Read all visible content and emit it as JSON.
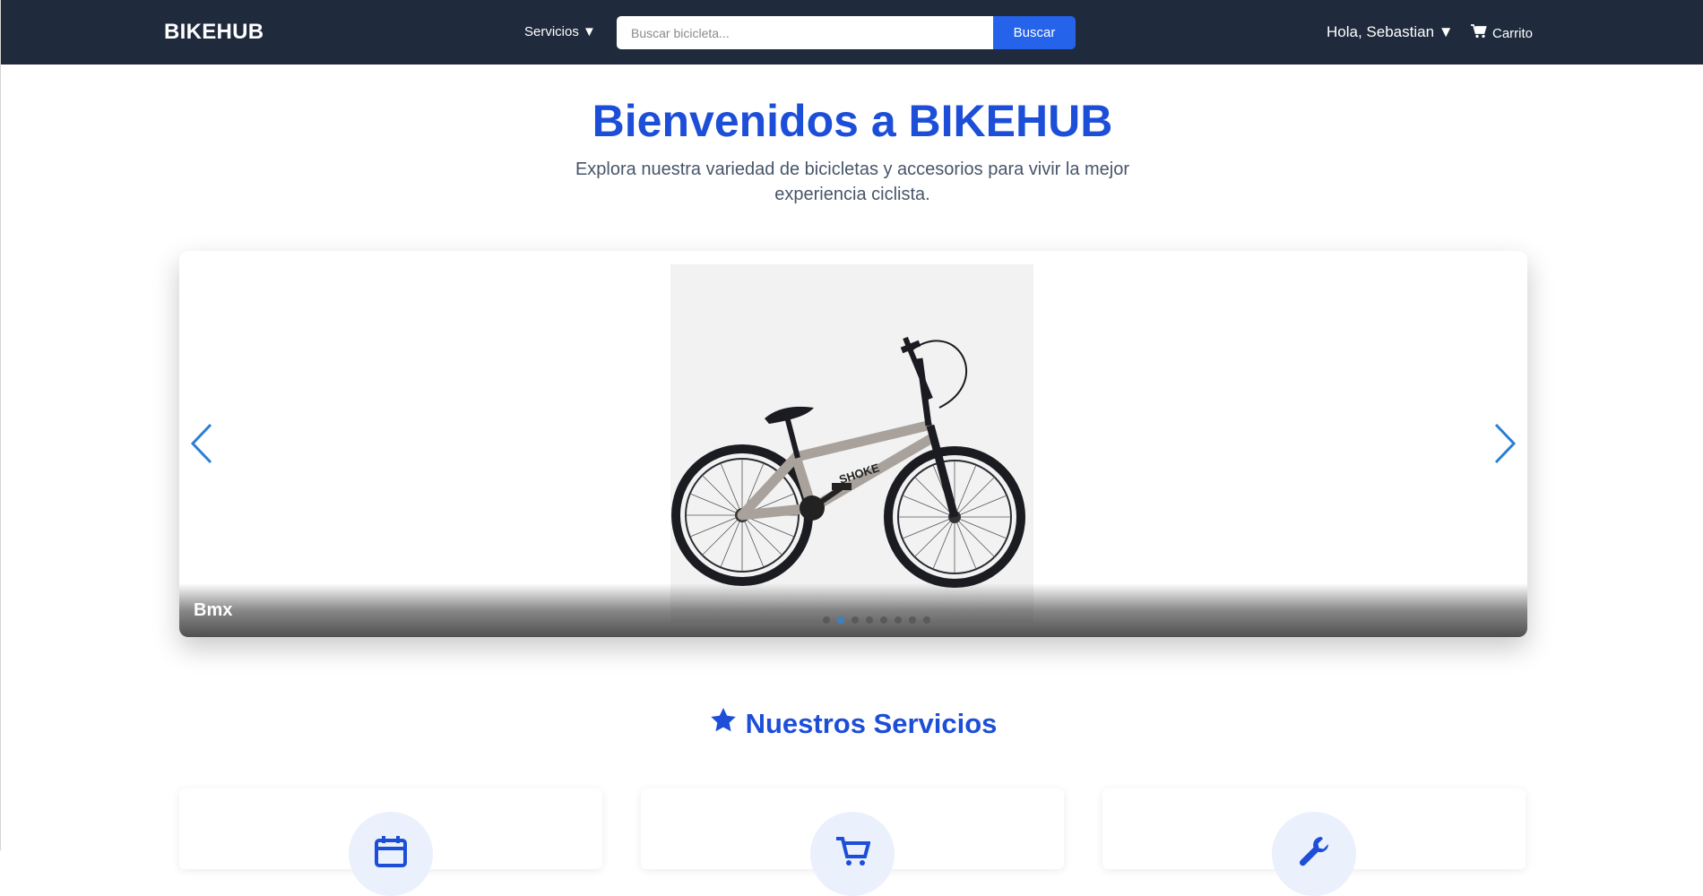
{
  "navbar": {
    "brand": "BIKEHUB",
    "services_menu": "Servicios ▼",
    "search": {
      "placeholder": "Buscar bicicleta...",
      "value": "",
      "button_label": "Buscar"
    },
    "user_menu": "Hola, Sebastian ▼",
    "cart_label": "Carrito",
    "cart_icon": "shopping-cart-icon"
  },
  "hero": {
    "title": "Bienvenidos a BIKEHUB",
    "subtitle": "Explora nuestra variedad de bicicletas y accesorios para vivir la mejor experiencia ciclista."
  },
  "carousel": {
    "caption": "Bmx",
    "slide_count": 8,
    "active_index": 1,
    "prev_icon": "chevron-left-icon",
    "next_icon": "chevron-right-icon",
    "arrow_color": "#2a7fd4"
  },
  "services": {
    "title": "Nuestros Servicios",
    "title_icon": "star-icon",
    "cards": [
      {
        "icon": "calendar-icon"
      },
      {
        "icon": "shopping-cart-icon"
      },
      {
        "icon": "wrench-icon"
      }
    ]
  },
  "colors": {
    "navbar_bg": "#1f2a3c",
    "accent": "#2563eb",
    "heading": "#1d4ed8"
  }
}
